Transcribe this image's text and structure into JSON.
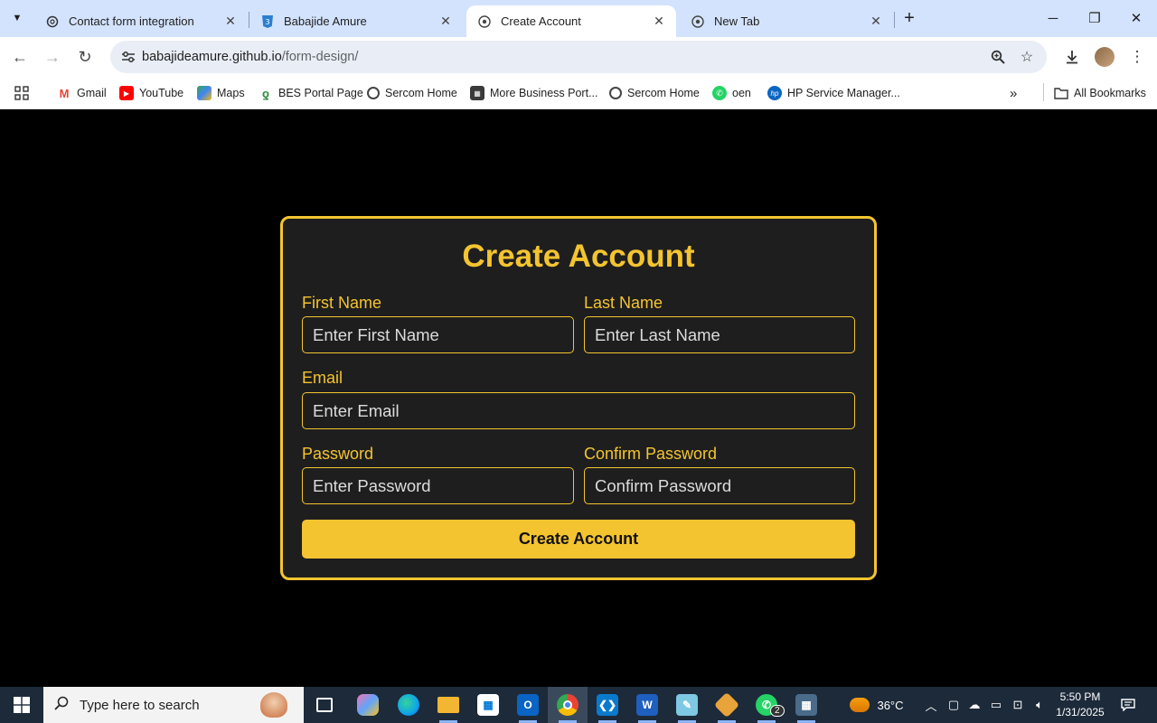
{
  "browser": {
    "tabs": [
      {
        "title": "Contact form integration",
        "active": false
      },
      {
        "title": "Babajide Amure",
        "active": false
      },
      {
        "title": "Create Account",
        "active": true
      },
      {
        "title": "New Tab",
        "active": false
      }
    ],
    "address": {
      "host": "babajideamure.github.io",
      "path": "/form-design/"
    },
    "bookmarks": [
      {
        "label": "Gmail",
        "icon": "gmail-icon"
      },
      {
        "label": "YouTube",
        "icon": "youtube-icon"
      },
      {
        "label": "Maps",
        "icon": "maps-icon"
      },
      {
        "label": "BES Portal Page",
        "icon": "bes-icon"
      },
      {
        "label": "Sercom Home",
        "icon": "globe-icon"
      },
      {
        "label": "More Business Port...",
        "icon": "business-icon"
      },
      {
        "label": "Sercom Home",
        "icon": "globe-icon"
      },
      {
        "label": "oen",
        "icon": "whatsapp-icon"
      },
      {
        "label": "HP Service Manager...",
        "icon": "hp-icon"
      }
    ],
    "all_bookmarks": "All Bookmarks"
  },
  "form": {
    "heading": "Create Account",
    "first_name": {
      "label": "First Name",
      "placeholder": "Enter First Name"
    },
    "last_name": {
      "label": "Last Name",
      "placeholder": "Enter Last Name"
    },
    "email": {
      "label": "Email",
      "placeholder": "Enter Email"
    },
    "password": {
      "label": "Password",
      "placeholder": "Enter Password"
    },
    "confirm_password": {
      "label": "Confirm Password",
      "placeholder": "Confirm Password"
    },
    "submit_label": "Create Account"
  },
  "colors": {
    "accent": "#f4c430",
    "card": "#1e1e1e",
    "background": "#000000"
  },
  "taskbar": {
    "search_placeholder": "Type here to search",
    "whatsapp_badge": "2",
    "temperature": "36°C",
    "time": "5:50 PM",
    "date": "1/31/2025"
  }
}
